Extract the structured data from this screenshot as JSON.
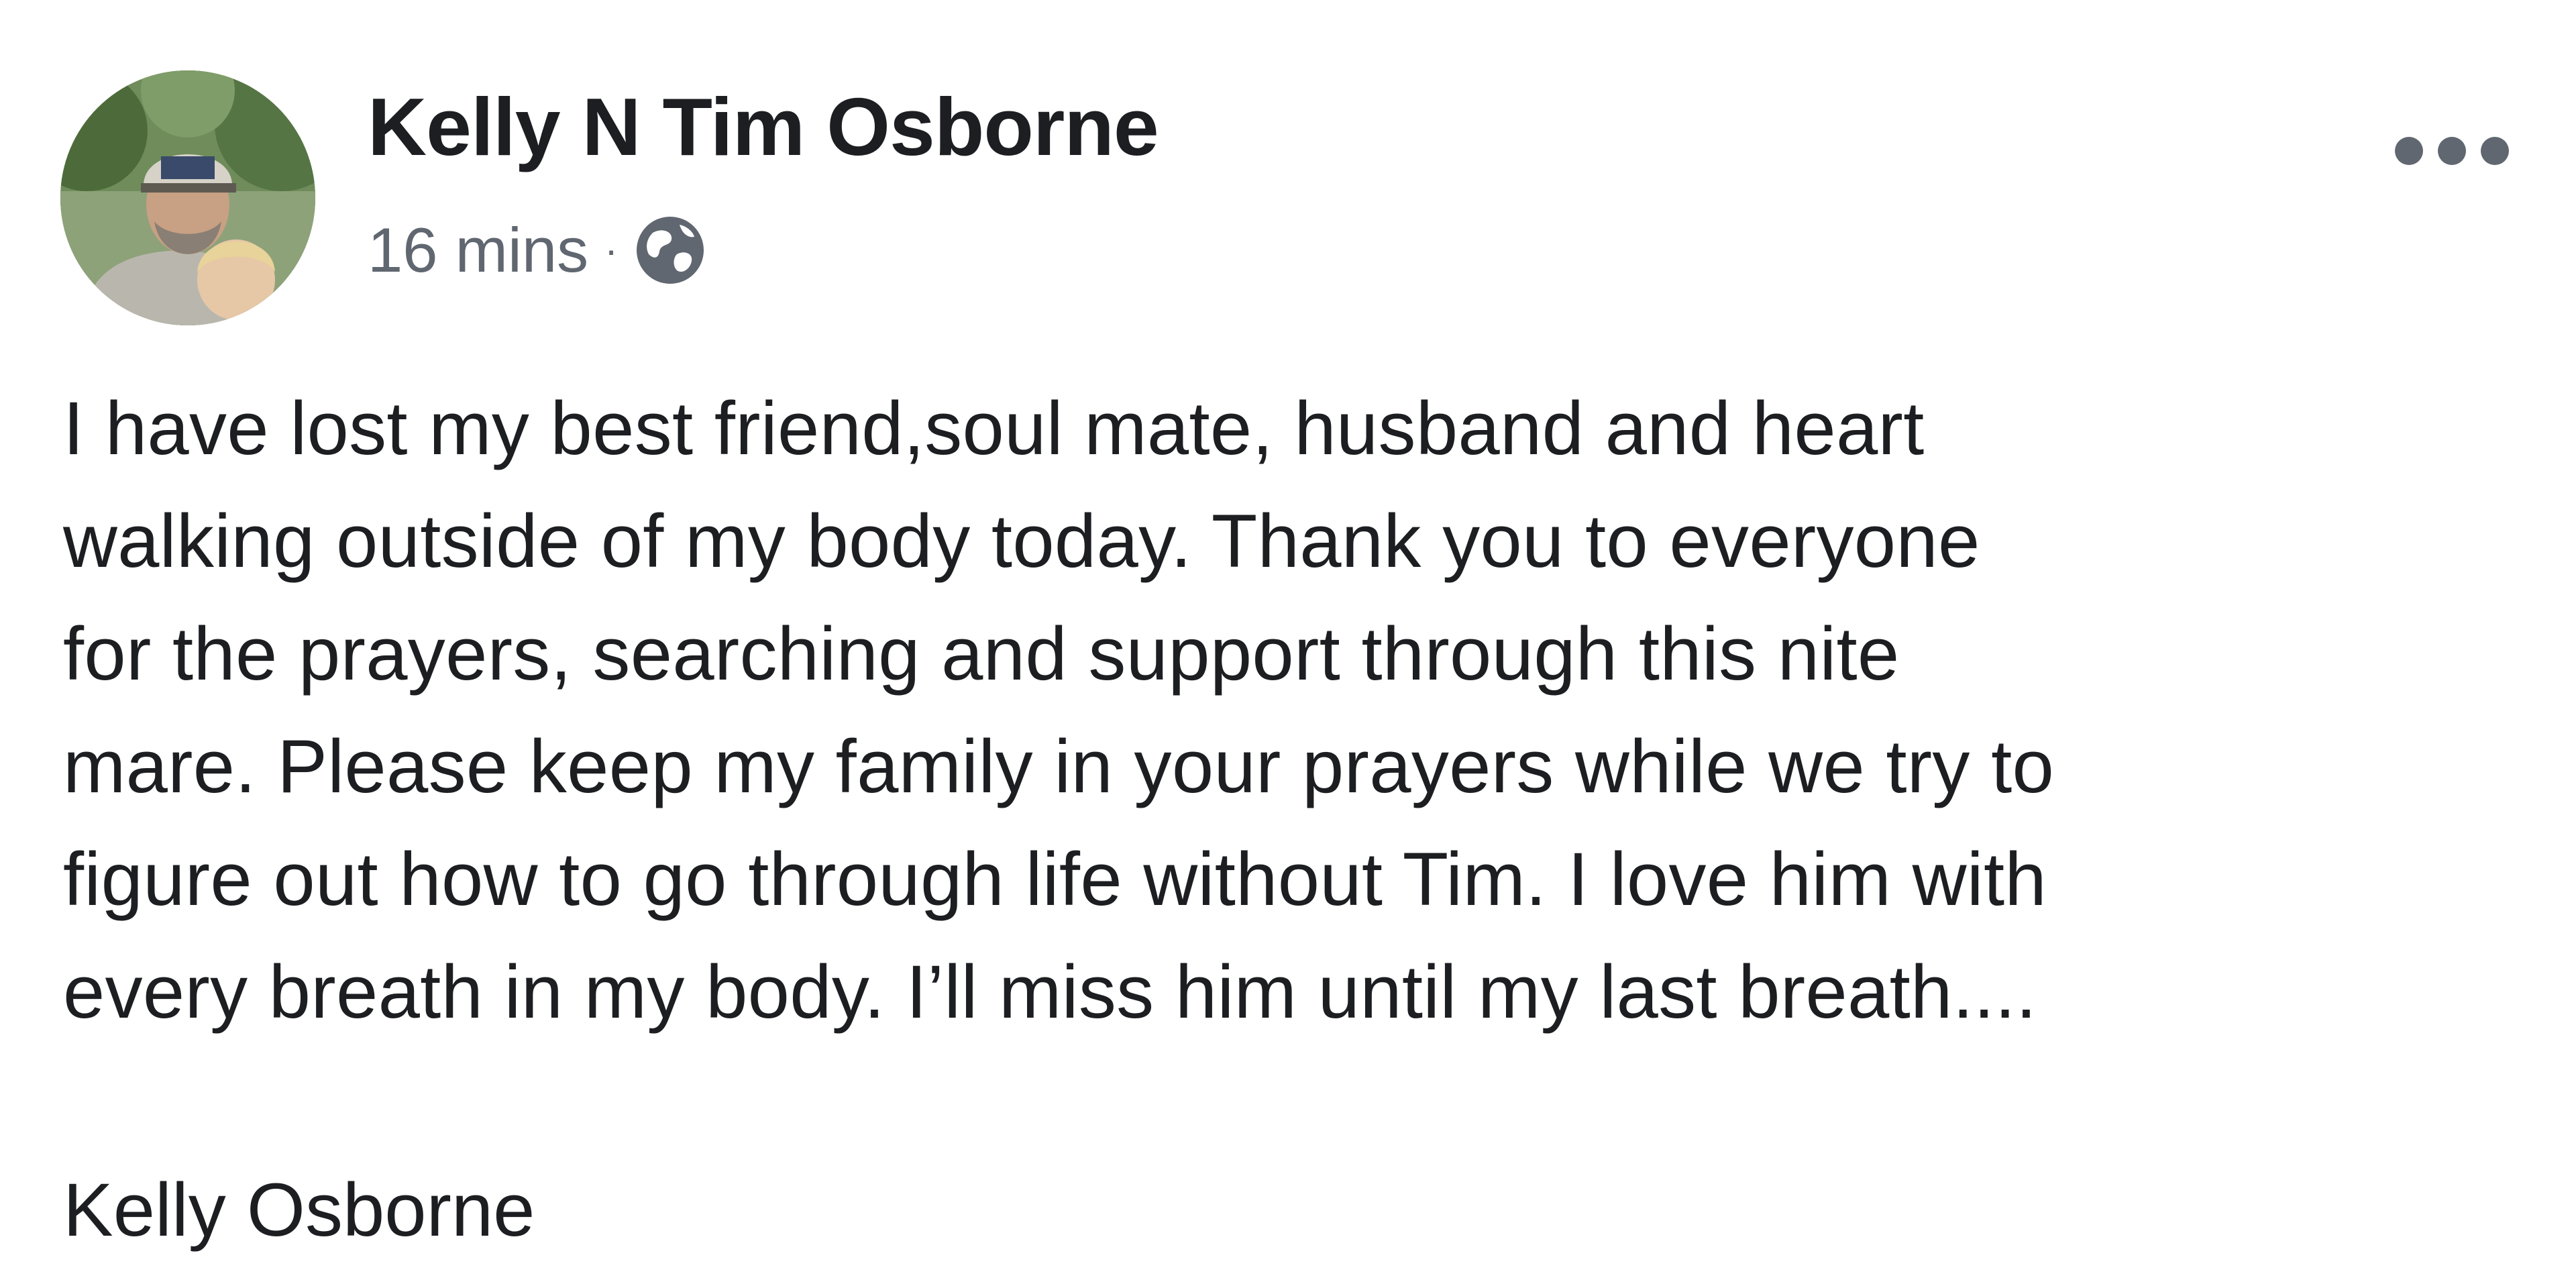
{
  "post": {
    "author": "Kelly N Tim Osborne",
    "timestamp": "16 mins",
    "separator": "·",
    "privacy_icon": "globe-icon",
    "more_icon": "more-horizontal-icon",
    "body_lines": [
      "I have lost my best friend,soul mate, husband and heart",
      "walking outside of my body today. Thank you to everyone",
      "for the prayers, searching and support through this nite",
      "mare. Please keep my family in your prayers while we try to",
      "figure out how to go through life without Tim. I love him with",
      "every breath in my body. I’ll miss him until my last breath...."
    ],
    "signature": "Kelly Osborne"
  },
  "colors": {
    "text_primary": "#1c1e21",
    "text_secondary": "#606770",
    "background": "#ffffff"
  }
}
